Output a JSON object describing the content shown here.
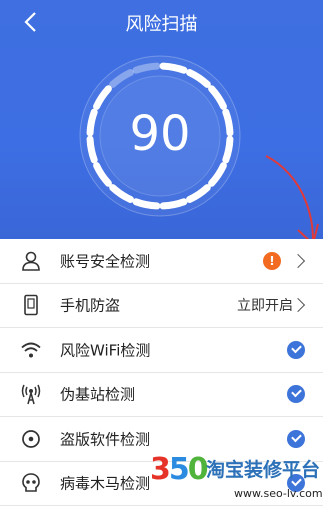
{
  "header": {
    "title": "风险扫描",
    "back_icon": "chevron-left-icon"
  },
  "gauge": {
    "score": "90",
    "score_value": 90,
    "max": 100,
    "tick_count": 16
  },
  "colors": {
    "hero_bg": "#3d6ee3",
    "warning": "#f26b21",
    "check": "#3d74d9",
    "annotation": "#e03a3a"
  },
  "items": [
    {
      "label": "账号安全检测",
      "icon": "user-icon",
      "status": "warning",
      "right_text": ""
    },
    {
      "label": "手机防盗",
      "icon": "phone-icon",
      "status": "action",
      "right_text": "立即开启"
    },
    {
      "label": "风险WiFi检测",
      "icon": "wifi-icon",
      "status": "checked",
      "right_text": ""
    },
    {
      "label": "伪基站检测",
      "icon": "antenna-icon",
      "status": "checked",
      "right_text": ""
    },
    {
      "label": "盗版软件检测",
      "icon": "disc-icon",
      "status": "checked",
      "right_text": ""
    },
    {
      "label": "病毒木马检测",
      "icon": "skull-icon",
      "status": "checked",
      "right_text": ""
    }
  ],
  "watermark": {
    "number": "350",
    "brand": "淘宝装修平台",
    "url": "www.seo-lv.com"
  }
}
